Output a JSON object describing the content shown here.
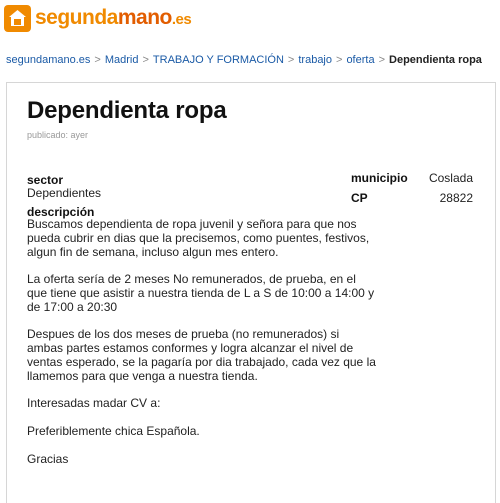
{
  "brand": {
    "part1": "segunda",
    "part2": "mano",
    "part3": ".es"
  },
  "breadcrumb": {
    "items": [
      "segundamano.es",
      "Madrid",
      "TRABAJO Y FORMACIÓN",
      "trabajo",
      "oferta"
    ],
    "current": "Dependienta ropa",
    "separator": ">"
  },
  "ad": {
    "title": "Dependienta ropa",
    "published": "publicado: ayer",
    "sector_label": "sector",
    "sector_value": "Dependientes",
    "municipio_label": "municipio",
    "municipio_value": "Coslada",
    "cp_label": "CP",
    "cp_value": "28822",
    "description_label": "descripción",
    "description": [
      "Buscamos dependienta de ropa juvenil y señora para que nos pueda cubrir en dias que la precisemos, como puentes, festivos, algun fin de semana, incluso algun mes entero.",
      "La oferta sería de 2 meses No remunerados, de prueba, en el que tiene que asistir a nuestra tienda de L a S de 10:00 a 14:00 y de 17:00 a 20:30",
      "Despues de los dos meses de prueba (no remunerados) si ambas partes estamos conformes y logra alcanzar el nivel de ventas esperado, se la pagaría por dia trabajado, cada vez que la llamemos para que venga a nuestra tienda.",
      "Interesadas madar CV a:",
      "Preferiblemente chica Española.",
      "Gracias"
    ]
  },
  "colors": {
    "brand_orange": "#f08a00",
    "brand_dark_orange": "#e25d00",
    "link": "#1a5aa6"
  }
}
